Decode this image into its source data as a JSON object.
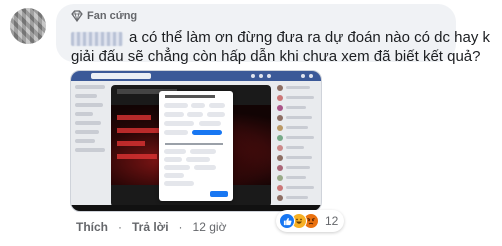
{
  "comment": {
    "badge_label": "Fan cứng",
    "author_name": "Vinh Minh",
    "text_line1": "a có thể làm ơn đừng đưa ra dự đoán nào có dc hay k",
    "text_line2": "giải đấu sẽ chẳng còn hấp dẫn khi chưa xem đã biết kết quả?",
    "actions": {
      "like": "Thích",
      "reply": "Trả lời",
      "time": "12 giờ",
      "separator": "·"
    },
    "reactions": {
      "types": [
        "like-icon",
        "haha-icon",
        "angry-icon"
      ],
      "count": "12"
    }
  },
  "colors": {
    "bubble": "#f0f2f5",
    "text": "#1c1e21",
    "muted": "#65676b",
    "facebook_blue": "#1877f2",
    "header_blue": "#3b5998"
  }
}
